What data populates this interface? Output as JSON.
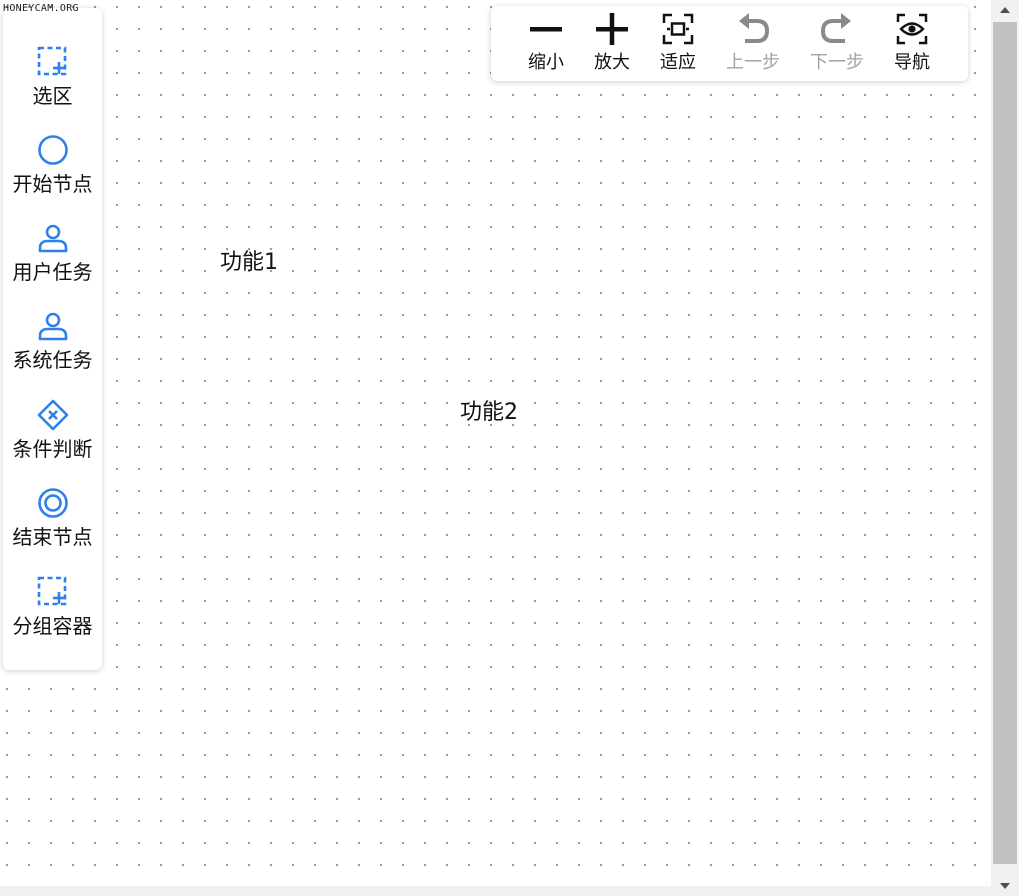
{
  "watermark": "HONEYCAM.ORG",
  "palette": {
    "items": [
      {
        "label": "选区",
        "icon": "dashed-select-plus-icon"
      },
      {
        "label": "开始节点",
        "icon": "circle-icon"
      },
      {
        "label": "用户任务",
        "icon": "user-icon"
      },
      {
        "label": "系统任务",
        "icon": "user-icon"
      },
      {
        "label": "条件判断",
        "icon": "diamond-x-icon"
      },
      {
        "label": "结束节点",
        "icon": "double-circle-icon"
      },
      {
        "label": "分组容器",
        "icon": "dashed-select-plus-icon"
      }
    ]
  },
  "toolbar": {
    "items": [
      {
        "label": "缩小",
        "icon": "minus-icon",
        "disabled": false
      },
      {
        "label": "放大",
        "icon": "plus-icon",
        "disabled": false
      },
      {
        "label": "适应",
        "icon": "fit-screen-icon",
        "disabled": false
      },
      {
        "label": "上一步",
        "icon": "undo-icon",
        "disabled": true
      },
      {
        "label": "下一步",
        "icon": "redo-icon",
        "disabled": true
      },
      {
        "label": "导航",
        "icon": "eye-icon",
        "disabled": false
      }
    ]
  },
  "canvas": {
    "nodes": [
      {
        "label": "功能1"
      },
      {
        "label": "功能2"
      }
    ]
  },
  "colors": {
    "accent": "#2f80ed",
    "toolbar_icon": "#111111",
    "disabled": "#8a8a8a"
  }
}
